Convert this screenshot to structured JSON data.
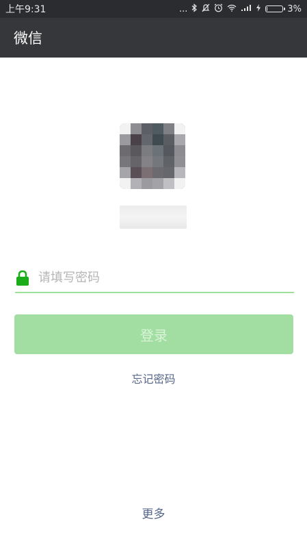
{
  "statusbar": {
    "time": "上午9:31",
    "dots": "...",
    "battery_percent": "3%",
    "battery_level": 0.03,
    "icons": [
      "bluetooth-icon",
      "mute-icon",
      "alarm-icon",
      "wifi-icon",
      "signal-icon",
      "charging-icon",
      "battery-icon"
    ]
  },
  "appbar": {
    "title": "微信"
  },
  "login": {
    "password_placeholder": "请填写密码",
    "password_value": "",
    "login_label": "登录",
    "forgot_label": "忘记密码",
    "more_label": "更多"
  },
  "colors": {
    "statusbar_bg": "#2b2c30",
    "appbar_bg": "#36373b",
    "accent_green": "#1aad19",
    "button_disabled": "#a2dea1",
    "link": "#56668a"
  }
}
